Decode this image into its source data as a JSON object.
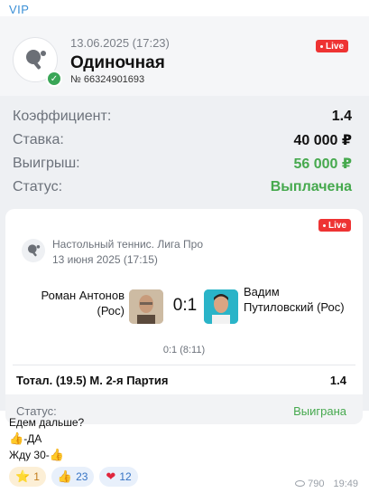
{
  "header": {
    "vip_label": "VIP"
  },
  "bet": {
    "date": "13.06.2025 (17:23)",
    "type": "Одиночная",
    "number": "№ 66324901693",
    "live_label": "Live",
    "rows": [
      {
        "label": "Коэффициент:",
        "value": "1.4"
      },
      {
        "label": "Ставка:",
        "value": "40 000 ₽"
      },
      {
        "label": "Выигрыш:",
        "value": "56 000 ₽"
      },
      {
        "label": "Статус:",
        "value": "Выплачена"
      }
    ]
  },
  "match": {
    "league": "Настольный теннис. Лига Про",
    "date": "13 июня 2025 (17:15)",
    "live_label": "Live",
    "player_left": "Роман Антонов (Рос)",
    "player_right": "Вадим Путиловский (Рос)",
    "score": "0:1",
    "set_score": "0:1 (8:11)",
    "market": "Тотал. (19.5) М. 2-я Партия",
    "odds": "1.4",
    "status_label": "Статус:",
    "status_value": "Выиграна"
  },
  "message": {
    "line1": "Едем дальше?",
    "line2": "-ДА",
    "line3": "Жду 30-"
  },
  "reactions": [
    {
      "icon": "star-icon",
      "count": "1"
    },
    {
      "icon": "thumbs-up-icon",
      "count": "23"
    },
    {
      "icon": "heart-icon",
      "count": "12"
    }
  ],
  "meta": {
    "views": "790",
    "time": "19:49"
  },
  "colors": {
    "accent_green": "#46a94e",
    "live_red": "#ee3333",
    "link_blue": "#3a8fd6"
  }
}
